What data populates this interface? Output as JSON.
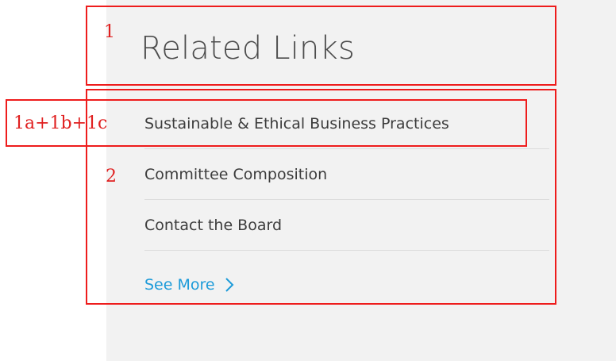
{
  "heading": "Related Links",
  "links": [
    {
      "label": "Sustainable & Ethical Business Practices"
    },
    {
      "label": "Committee Composition"
    },
    {
      "label": "Contact the Board"
    }
  ],
  "see_more": "See More",
  "annotations": {
    "label_1": "1",
    "label_1abc": "1a+1b+1c",
    "label_2": "2"
  },
  "colors": {
    "panel_background": "#f2f2f2",
    "heading_text": "#4d4d4d",
    "link_text": "#3c3c3c",
    "see_more_link": "#1d9bd9",
    "annotation": "#ee1c1c"
  },
  "icons": {
    "see_more": "chevron-right-icon"
  }
}
